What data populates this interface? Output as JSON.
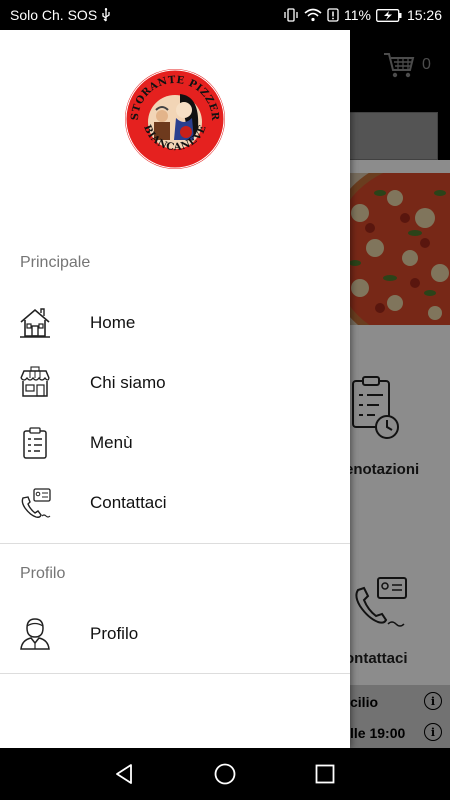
{
  "status_bar": {
    "carrier": "Solo Ch. SOS",
    "usb_icon": "usb-icon",
    "battery_percent": "11%",
    "time": "15:26"
  },
  "background": {
    "cart_count": "0",
    "tile1_label": "enotazioni",
    "tile2_label": "ontattaci",
    "row1": "cilio",
    "row2": "lle 19:00",
    "info_glyph": "i"
  },
  "drawer": {
    "logo": {
      "top_text": "RISTORANTE PIZZERIA",
      "bottom_text": "BIANCANEVE"
    },
    "sections": [
      {
        "title": "Principale",
        "items": [
          {
            "label": "Home",
            "icon": "home-icon"
          },
          {
            "label": "Chi siamo",
            "icon": "shop-icon"
          },
          {
            "label": "Menù",
            "icon": "menu-list-icon"
          },
          {
            "label": "Contattaci",
            "icon": "phone-contact-icon"
          }
        ]
      },
      {
        "title": "Profilo",
        "items": [
          {
            "label": "Profilo",
            "icon": "user-icon"
          }
        ]
      }
    ]
  },
  "colors": {
    "accent_red": "#e5211f",
    "section_gray": "#757575",
    "divider": "#dddddd"
  },
  "nav_bar": {
    "back": "back-triangle-icon",
    "home": "home-circle-icon",
    "recents": "recents-square-icon"
  }
}
